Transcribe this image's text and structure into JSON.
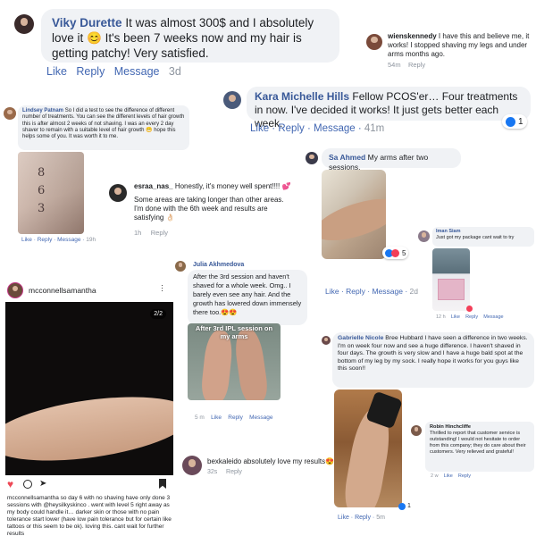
{
  "c1": {
    "name": "Viky Durette",
    "text": "It was almost 300$ and I absolutely love it 😊 It's been 7 weeks now and my hair is getting patchy! Very satisfied.",
    "like": "Like",
    "reply": "Reply",
    "message": "Message",
    "time": "3d"
  },
  "c2": {
    "name": "wienskennedy",
    "text": "I have this and believe me, it works! I stopped shaving my legs and under arms months ago.",
    "time": "54m",
    "reply": "Reply"
  },
  "c3": {
    "name": "Kara Michelle Hills",
    "text": "Fellow PCOS'er… Four treatments in now. I've decided it works! It just gets better each week.",
    "like": "Like",
    "reply": "Reply",
    "message": "Message",
    "time": "41m",
    "reactions": "1"
  },
  "c4": {
    "name": "Lindsey Patnam",
    "text": "So I did a test to see the difference of different number of treatments. You can see the different levels of hair growth this is after almost 2 weeks of not shaving. I was an every 2 day shaver to remain with a suitable level of hair growth 😁 hope this helps some of you. It was worth it to me.",
    "like": "Like",
    "reply": "Reply",
    "message": "Message",
    "time": "19h"
  },
  "c5": {
    "name": "Sa Ahmed",
    "text": "My arms after two sessions.",
    "like": "Like",
    "reply": "Reply",
    "message": "Message",
    "time": "2d",
    "reactions": "5"
  },
  "c6": {
    "name": "esraa_nas_",
    "text1": "Honestly, it's money well spent!!!! 💕",
    "text2": "Some areas are taking longer than other areas. I'm done with the 6th week and results are satisfying 👌🏻",
    "time": "1h",
    "reply": "Reply"
  },
  "c7": {
    "name": "Iman Siam",
    "text": "Just got my package cant wait to try",
    "time": "12 h",
    "like": "Like",
    "reply": "Reply",
    "message": "Message"
  },
  "c8": {
    "name": "mcconnellsamantha",
    "counter": "2/2",
    "username": "mcconnellsamantha",
    "caption": "so day 6 with no shaving have only done 3 sessions with @heysilkyskinco . went with level 5 right away as my body could handle it… darker skin or those with no pain tolerance start lower (have low pain tolerance but for certain like tattoos or this seem to be ok). loving this. cant wait for further results"
  },
  "c9": {
    "name": "Julia Akhmedova",
    "text": "After the 3rd session and haven't shaved for a whole week.  Omg.. I barely even see any hair.  And the growth has lowered down immensely there too.😍😍",
    "photo_caption": "After 3rd IPL session on my arms",
    "time": "5 m",
    "like": "Like",
    "reply": "Reply",
    "message": "Message"
  },
  "c10": {
    "name": "Gabrielle Nicole",
    "text": "Bree Hubbard I have seen a difference in two weeks. I'm on week four now and see a huge difference. I haven't shaved in four days. The growth is very slow and I have a huge bald spot at the bottom of my leg by my sock. I really hope it works for you guys like this soon!!",
    "like": "Like",
    "reply": "Reply",
    "time": "5m",
    "reactions": "1"
  },
  "c11": {
    "name": "Robin Hinchcliffe",
    "text": "Thrilled to report that customer service is outstanding!  I would not hesitate to order from this company; they do care about their customers.  Very relieved and grateful!",
    "time": "2 w",
    "like": "Like",
    "reply": "Reply"
  },
  "c12": {
    "name": "bexkaleido",
    "text": "absolutely love my results😍",
    "time": "32s",
    "reply": "Reply"
  }
}
